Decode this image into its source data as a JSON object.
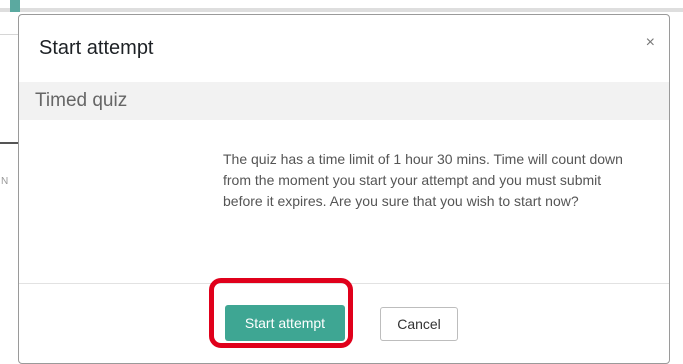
{
  "background": {
    "side_glyph": "N"
  },
  "dialog": {
    "title": "Start attempt",
    "close_icon": "close-icon",
    "close_glyph": "×",
    "section_title": "Timed quiz",
    "message": "The quiz has a time limit of 1 hour 30 mins. Time will count down from the moment you start your attempt and you must submit before it expires. Are you sure that you wish to start now?",
    "primary_button": "Start attempt",
    "secondary_button": "Cancel"
  },
  "colors": {
    "primary": "#3ea693",
    "highlight": "#e0001b",
    "section_band": "#f2f2f2"
  }
}
